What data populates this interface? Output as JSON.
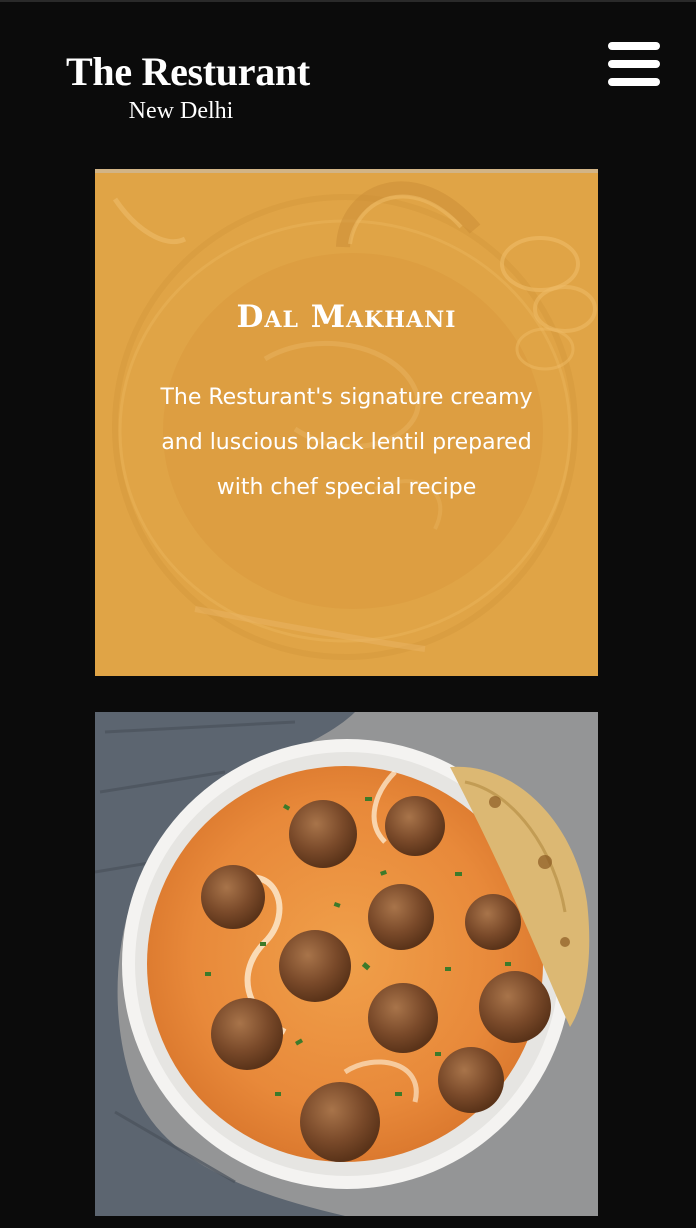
{
  "header": {
    "brand_name": "The Resturant",
    "location": "New Delhi",
    "menu_icon": "hamburger-menu-icon"
  },
  "cards": [
    {
      "title": "Dal Makhani",
      "description": "The Resturant's signature creamy and luscious black lentil prepared with chef special recipe",
      "overlay_color": "#e0a446",
      "image": "dal-makhani-bowl-photo"
    },
    {
      "image": "kofta-curry-with-roti-photo"
    }
  ],
  "colors": {
    "background": "#0b0b0b",
    "text": "#ffffff",
    "accent": "#e0a446"
  }
}
